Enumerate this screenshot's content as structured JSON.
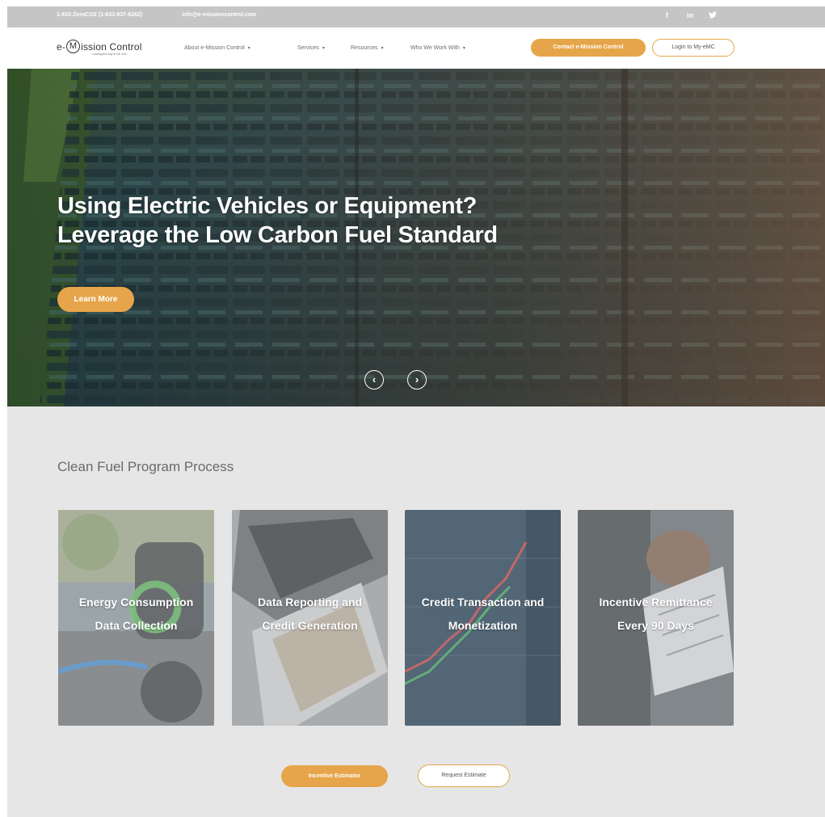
{
  "topbar": {
    "phone": "1-833-ZeroCO2 (1-833-937-6262)",
    "email": "info@e-missioncontrol.com",
    "social": [
      {
        "icon": "facebook-icon",
        "glyph": "f"
      },
      {
        "icon": "linkedin-icon",
        "glyph": "in"
      },
      {
        "icon": "twitter-icon",
        "glyph": "🐦"
      }
    ]
  },
  "header": {
    "logo": {
      "prefix": "e-",
      "ring_letter": "M",
      "suffix": "ission Control",
      "tagline": "Leading the way to net zero"
    },
    "nav": [
      {
        "label": "About e-Mission Control",
        "caret": "▾"
      },
      {
        "label": "Services",
        "caret": "▾"
      },
      {
        "label": "Resources",
        "caret": "▾"
      },
      {
        "label": "Who We Work With",
        "caret": "▾"
      }
    ],
    "contact_button": "Contact e-Mission Control",
    "login_button": "Login to My-eMC"
  },
  "hero": {
    "title_line1": "Using Electric Vehicles or Equipment?",
    "title_line2": "Leverage the Low Carbon Fuel Standard",
    "cta": "Learn More",
    "prev_glyph": "‹",
    "next_glyph": "›"
  },
  "process": {
    "title": "Clean Fuel Program Process",
    "cards": [
      {
        "line1": "Energy Consumption",
        "line2": "Data Collection"
      },
      {
        "line1": "Data Reporting and",
        "line2": "Credit Generation"
      },
      {
        "line1": "Credit Transaction and",
        "line2": "Monetization"
      },
      {
        "line1": "Incentive Remittance",
        "line2": "Every 90 Days"
      }
    ],
    "incentive_button": "Incentive Estimator",
    "request_button": "Request Estimate"
  },
  "colors": {
    "accent": "#e6a54a",
    "topbar": "#c5c5c5",
    "section_bg": "#e6e6e6"
  }
}
